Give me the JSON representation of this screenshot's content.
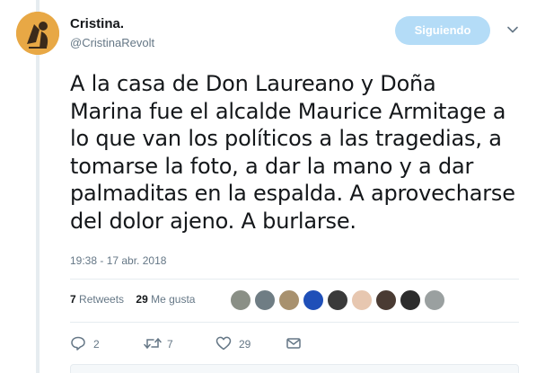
{
  "author": {
    "name": "Cristina.",
    "handle": "@CristinaRevolt"
  },
  "follow_button": {
    "label": "Siguiendo"
  },
  "tweet": {
    "lines": [
      "A la casa de Don Laureano y Doña",
      "Marina fue el alcalde Maurice Armitage a",
      "lo que van los políticos a las tragedias, a",
      "tomarse la foto, a dar la mano y a dar",
      "palmaditas en la espalda. A aprovecharse",
      "del dolor ajeno. A burlarse."
    ],
    "timestamp": "19:38 - 17 abr. 2018"
  },
  "stats": {
    "retweets_count": "7",
    "retweets_label": "Retweets",
    "likes_count": "29",
    "likes_label": "Me gusta"
  },
  "liker_avatars": [
    "#8a8f86",
    "#6f7d84",
    "#a8916e",
    "#1f4fb8",
    "#3a3a3a",
    "#e7c7b0",
    "#4a3b33",
    "#2c2c2c",
    "#9aa0a0"
  ],
  "actions": {
    "reply_count": "2",
    "retweet_count": "7",
    "like_count": "29"
  },
  "colors": {
    "follow_button_bg": "#b4dcf7",
    "muted_text": "#657786",
    "avatar_bg": "#e8a845"
  },
  "icons": {
    "caret": "chevron-down-icon",
    "reply": "reply-icon",
    "retweet": "retweet-icon",
    "like": "heart-icon",
    "message": "envelope-icon"
  }
}
